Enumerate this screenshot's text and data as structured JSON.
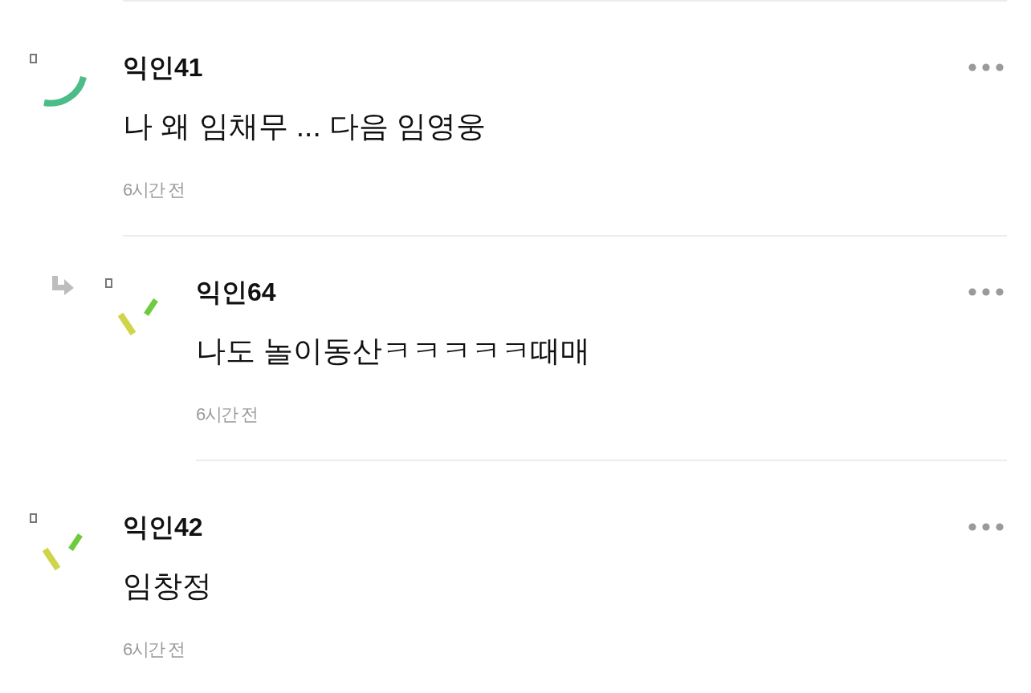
{
  "comments": [
    {
      "author": "익인41",
      "text": "나 왜 임채무 ... 다음 임영웅",
      "time": "6시간 전",
      "avatar": {
        "kind": "arc"
      },
      "children": [
        {
          "author": "익인64",
          "text": "나도 놀이동산ㅋㅋㅋㅋㅋ때매",
          "time": "6시간 전",
          "avatar": {
            "kind": "dashes"
          }
        }
      ]
    },
    {
      "author": "익인42",
      "text": "임창정",
      "time": "6시간 전",
      "avatar": {
        "kind": "dashes"
      }
    }
  ]
}
